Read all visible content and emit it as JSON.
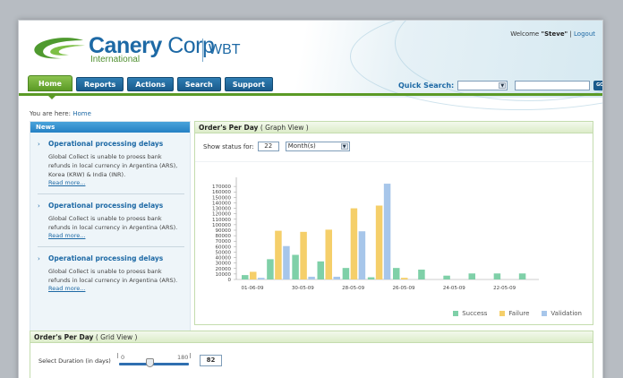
{
  "header": {
    "brand": "Canery",
    "brand_corp": "Corp",
    "brand_sub": "International",
    "product": "WBT",
    "welcome_prefix": "Welcome",
    "user": "\"Steve\"",
    "logout": "Logout"
  },
  "nav": {
    "items": [
      "Home",
      "Reports",
      "Actions",
      "Search",
      "Support"
    ],
    "active": "Home"
  },
  "quick_search": {
    "label": "Quick Search:",
    "select_value": "",
    "input_value": "",
    "go_label": "GO"
  },
  "breadcrumb": {
    "prefix": "You are here:",
    "current": "Home"
  },
  "news": {
    "title": "News",
    "items": [
      {
        "title": "Operational processing delays",
        "body": "Global Collect is unable to proess bank refunds in local currency in Argentina (ARS), Korea (KRW) & India (INR).",
        "more": "Read more..."
      },
      {
        "title": "Operational processing delays",
        "body": "Global Collect is unable to proess bank refunds in local currency in Argentina (ARS).",
        "more": "Read more..."
      },
      {
        "title": "Operational processing delays",
        "body": "Global Collect is unable to proess bank refunds in local currency in Argentina (ARS).",
        "more": "Read more..."
      }
    ]
  },
  "graph_panel": {
    "title": "Order's Per Day",
    "subtitle": "( Graph View )",
    "status_label": "Show status for:",
    "status_value": "22",
    "period_value": "Month(s)"
  },
  "grid_panel": {
    "title": "Order's Per Day",
    "subtitle": "( Grid View )",
    "duration_label": "Select Duration (in days)",
    "slider_min": "0",
    "slider_max": "180",
    "duration_value": "82",
    "slider_fraction": 0.46
  },
  "chart_data": {
    "type": "bar",
    "ylim": [
      0,
      180000
    ],
    "y_ticks": [
      "0",
      "10000",
      "20000",
      "30000",
      "40000",
      "50000",
      "60000",
      "70000",
      "80000",
      "90000",
      "100000",
      "110000",
      "120000",
      "130000",
      "140000",
      "150000",
      "160000",
      "170000"
    ],
    "x_tick_labels": [
      "01-06-09",
      "30-05-09",
      "28-05-09",
      "26-05-09",
      "24-05-09",
      "22-05-09"
    ],
    "series": [
      {
        "name": "Success",
        "color": "#7fd0a8",
        "values": [
          8000,
          37000,
          45000,
          33000,
          21000,
          4000,
          21000,
          18000,
          7000,
          11000,
          11000,
          11000
        ]
      },
      {
        "name": "Failure",
        "color": "#f5cf6a",
        "values": [
          14000,
          89000,
          87000,
          91000,
          130000,
          135000,
          3000,
          0,
          0,
          0,
          0,
          0
        ]
      },
      {
        "name": "Validation",
        "color": "#a7c6ea",
        "values": [
          3000,
          61000,
          5000,
          5000,
          88000,
          175000,
          0,
          0,
          0,
          0,
          0,
          0
        ]
      }
    ]
  }
}
